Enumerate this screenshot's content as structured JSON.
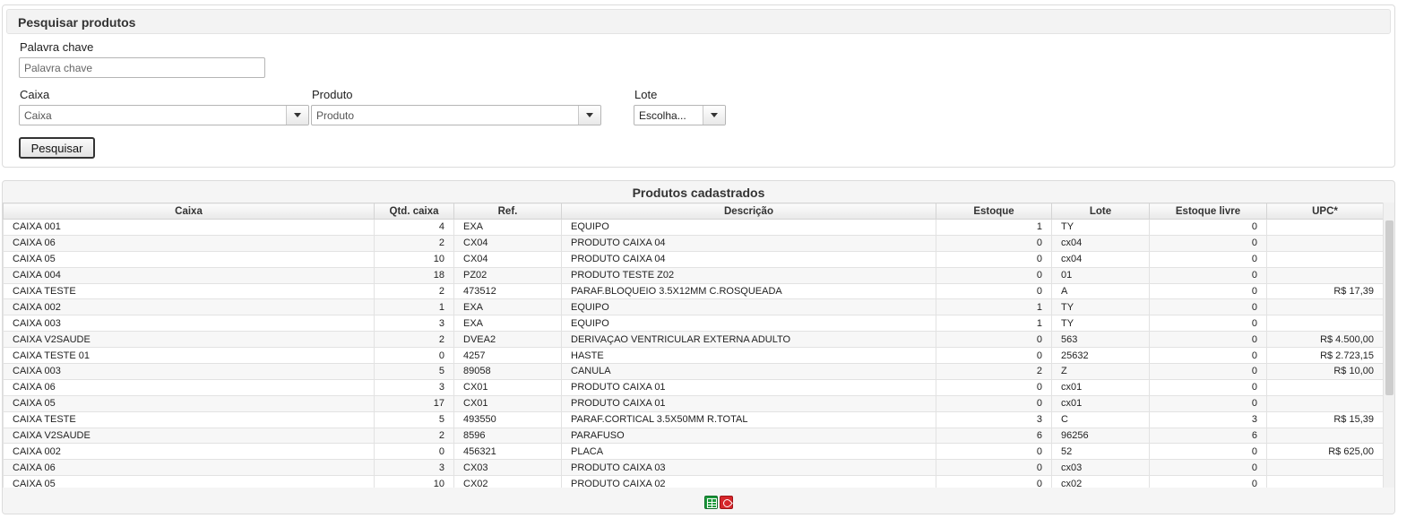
{
  "search": {
    "title": "Pesquisar produtos",
    "keyword_label": "Palavra chave",
    "keyword_placeholder": "Palavra chave",
    "caixa_label": "Caixa",
    "caixa_value": "Caixa",
    "produto_label": "Produto",
    "produto_value": "Produto",
    "lote_label": "Lote",
    "lote_value": "Escolha...",
    "search_button": "Pesquisar"
  },
  "results": {
    "title": "Produtos cadastrados",
    "columns": [
      "Caixa",
      "Qtd. caixa",
      "Ref.",
      "Descrição",
      "Estoque",
      "Lote",
      "Estoque livre",
      "UPC*"
    ],
    "rows": [
      [
        "CAIXA 001",
        "4",
        "EXA",
        "EQUIPO",
        "1",
        "TY",
        "0",
        ""
      ],
      [
        "CAIXA 06",
        "2",
        "CX04",
        "PRODUTO CAIXA 04",
        "0",
        "cx04",
        "0",
        ""
      ],
      [
        "CAIXA 05",
        "10",
        "CX04",
        "PRODUTO CAIXA 04",
        "0",
        "cx04",
        "0",
        ""
      ],
      [
        "CAIXA 004",
        "18",
        "PZ02",
        "PRODUTO TESTE Z02",
        "0",
        "01",
        "0",
        ""
      ],
      [
        "CAIXA TESTE",
        "2",
        "473512",
        "PARAF.BLOQUEIO 3.5X12MM C.ROSQUEADA",
        "0",
        "A",
        "0",
        "R$ 17,39"
      ],
      [
        "CAIXA 002",
        "1",
        "EXA",
        "EQUIPO",
        "1",
        "TY",
        "0",
        ""
      ],
      [
        "CAIXA 003",
        "3",
        "EXA",
        "EQUIPO",
        "1",
        "TY",
        "0",
        ""
      ],
      [
        "CAIXA V2SAUDE",
        "2",
        "DVEA2",
        "DERIVAÇAO VENTRICULAR EXTERNA ADULTO",
        "0",
        "563",
        "0",
        "R$ 4.500,00"
      ],
      [
        "CAIXA TESTE 01",
        "0",
        "4257",
        "HASTE",
        "0",
        "25632",
        "0",
        "R$ 2.723,15"
      ],
      [
        "CAIXA 003",
        "5",
        "89058",
        "CANULA",
        "2",
        "Z",
        "0",
        "R$ 10,00"
      ],
      [
        "CAIXA 06",
        "3",
        "CX01",
        "PRODUTO CAIXA 01",
        "0",
        "cx01",
        "0",
        ""
      ],
      [
        "CAIXA 05",
        "17",
        "CX01",
        "PRODUTO CAIXA 01",
        "0",
        "cx01",
        "0",
        ""
      ],
      [
        "CAIXA TESTE",
        "5",
        "493550",
        "PARAF.CORTICAL 3.5X50MM R.TOTAL",
        "3",
        "C",
        "3",
        "R$ 15,39"
      ],
      [
        "CAIXA V2SAUDE",
        "2",
        "8596",
        "PARAFUSO",
        "6",
        "96256",
        "6",
        ""
      ],
      [
        "CAIXA 002",
        "0",
        "456321",
        "PLACA",
        "0",
        "52",
        "0",
        "R$ 625,00"
      ],
      [
        "CAIXA 06",
        "3",
        "CX03",
        "PRODUTO CAIXA 03",
        "0",
        "cx03",
        "0",
        ""
      ],
      [
        "CAIXA 05",
        "10",
        "CX02",
        "PRODUTO CAIXA 02",
        "0",
        "cx02",
        "0",
        ""
      ]
    ]
  },
  "footer": {
    "icons": [
      "excel-export-icon",
      "pdf-export-icon"
    ]
  },
  "colors": {
    "excel": "#1d9a3c",
    "pdf": "#d6262b"
  }
}
